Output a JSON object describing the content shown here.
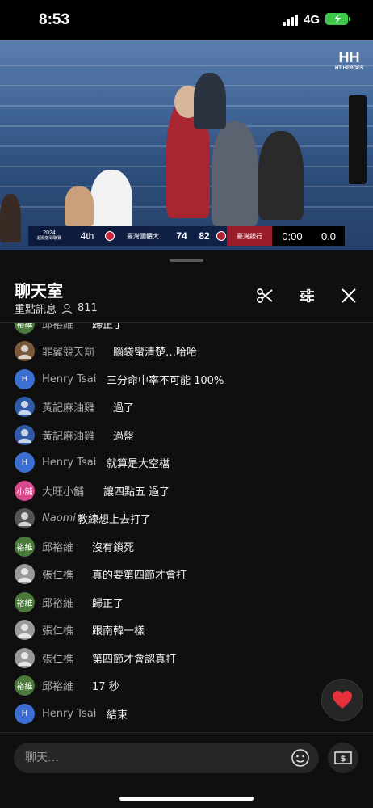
{
  "status_bar": {
    "time": "8:53",
    "network": "4G"
  },
  "video": {
    "logo": "HH",
    "logo_sub": "HT HEROES",
    "scoreboard": {
      "league": "2024",
      "league_sub": "超級籃球聯賽",
      "quarter": "4th",
      "team_left": "臺灣國體大",
      "score_left": "74",
      "score_right": "82",
      "team_right": "臺灣銀行",
      "clock": "0:00",
      "shot_clock": "0.0"
    }
  },
  "chat": {
    "title": "聊天室",
    "subtitle": "重點訊息",
    "viewer_count": "811",
    "messages": [
      {
        "author": "邱裕維",
        "text": "歸正了",
        "avatar": "裕維",
        "avatar_color": "#4a7a3a"
      },
      {
        "author": "罪翼競天罰",
        "text": "腦袋蠻清楚…哈哈",
        "avatar": "",
        "avatar_color": "#7a5a3a"
      },
      {
        "author": "Henry Tsai",
        "text": "三分命中率不可能 100%",
        "avatar": "H",
        "avatar_color": "#3b6fd1"
      },
      {
        "author": "黃記麻油雞",
        "text": "過了",
        "avatar": "",
        "avatar_color": "#2f5aa8"
      },
      {
        "author": "黃記麻油雞",
        "text": "過盤",
        "avatar": "",
        "avatar_color": "#2f5aa8"
      },
      {
        "author": "Henry Tsai",
        "text": "就算是大空檔",
        "avatar": "H",
        "avatar_color": "#3b6fd1"
      },
      {
        "author": "大旺小舖",
        "text": "讓四點五 過了",
        "avatar": "小舖",
        "avatar_color": "#d94a8a"
      },
      {
        "author": "Naomi",
        "text": "教練想上去打了",
        "avatar": "",
        "avatar_color": "#555555"
      },
      {
        "author": "邱裕維",
        "text": "沒有鎖死",
        "avatar": "裕維",
        "avatar_color": "#4a7a3a"
      },
      {
        "author": "張仁樵",
        "text": "真的要第四節才會打",
        "avatar": "",
        "avatar_color": "#9a9a9a"
      },
      {
        "author": "邱裕維",
        "text": "歸正了",
        "avatar": "裕維",
        "avatar_color": "#4a7a3a"
      },
      {
        "author": "張仁樵",
        "text": "跟南韓一樣",
        "avatar": "",
        "avatar_color": "#9a9a9a"
      },
      {
        "author": "張仁樵",
        "text": "第四節才會認真打",
        "avatar": "",
        "avatar_color": "#9a9a9a"
      },
      {
        "author": "邱裕維",
        "text": "17 秒",
        "avatar": "裕維",
        "avatar_color": "#4a7a3a"
      },
      {
        "author": "Henry Tsai",
        "text": "結束",
        "avatar": "H",
        "avatar_color": "#3b6fd1"
      }
    ],
    "input_placeholder": "聊天…",
    "icons": {
      "clip": "scissors-icon",
      "filter": "sliders-icon",
      "close": "close-icon",
      "heart": "heart-icon",
      "emoji": "emoji-icon",
      "money": "money-icon"
    },
    "heart_color": "#e8303a"
  }
}
